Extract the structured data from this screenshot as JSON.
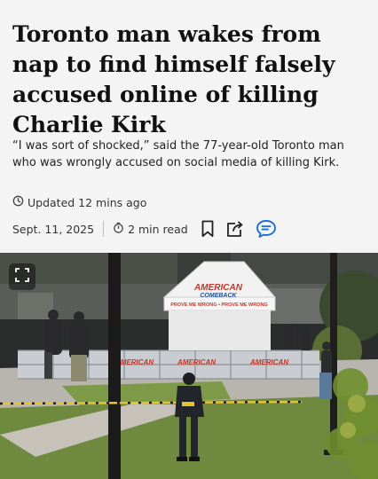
{
  "article": {
    "headline": "Toronto man wakes from nap to find himself falsely accused online of killing Charlie Kirk",
    "dek": "“I was sort of shocked,” said the 77-year-old Toronto man who was wrongly accused on social media of killing Kirk.",
    "updated": "Updated 12 mins ago",
    "date": "Sept. 11, 2025",
    "read_time": "2 min read"
  },
  "photo": {
    "tent_label": "AMERICAN COMEBACK",
    "tent_label_line1": "AMERICAN",
    "tent_label_line2": "COMEBACK",
    "tent_sub": "PROVE ME WRONG • PROVE ME WRONG",
    "banner_text": "AMERICAN COMEBACK",
    "banner_1": "AMERICAN",
    "banner_2": "AMERICAN",
    "banner_3": "AMERICAN"
  },
  "colors": {
    "background": "#f4f4f4",
    "text": "#111111",
    "accent_blue": "#1e6fd9"
  },
  "icons": {
    "updated": "clock-icon",
    "read_time": "stopwatch-icon",
    "bookmark": "bookmark-icon",
    "share": "share-icon",
    "comments": "comment-icon",
    "expand": "expand-icon"
  }
}
